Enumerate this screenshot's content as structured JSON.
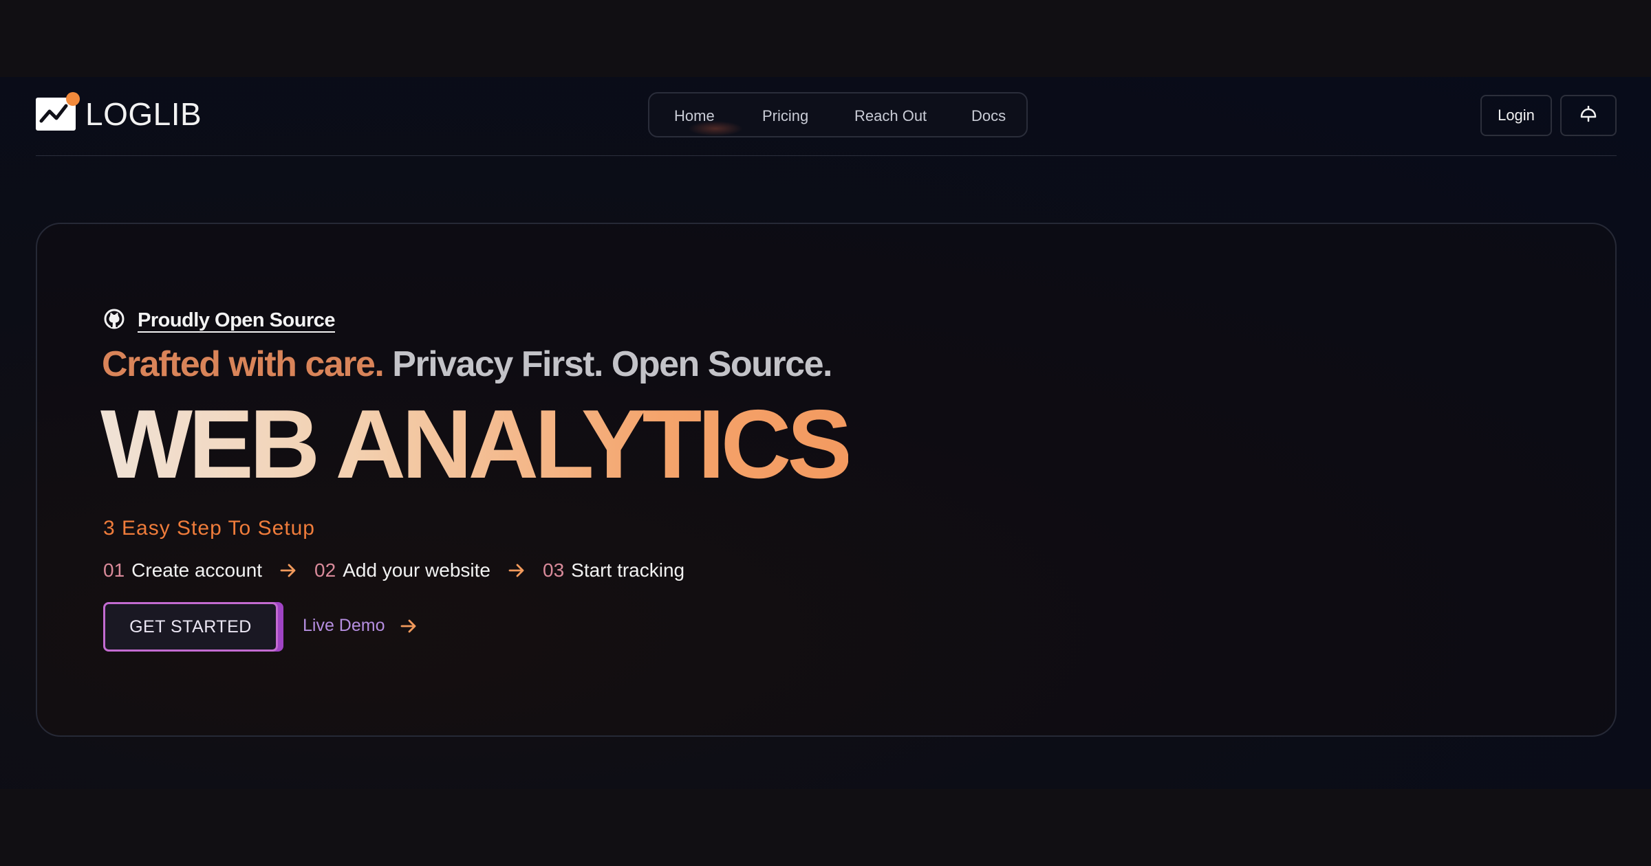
{
  "header": {
    "logo_text": "LOGLIB",
    "nav": [
      {
        "label": "Home"
      },
      {
        "label": "Pricing"
      },
      {
        "label": "Reach Out"
      },
      {
        "label": "Docs"
      }
    ],
    "login_label": "Login",
    "theme_icon": "lamp-icon"
  },
  "hero": {
    "open_source_icon": "github-icon",
    "open_source_link": "Proudly Open Source",
    "tagline_highlight": "Crafted with care.",
    "tagline_rest": "Privacy First. Open Source.",
    "headline": "WEB ANALYTICS",
    "steps_title": "3 Easy Step To Setup",
    "steps": [
      {
        "num": "01",
        "label": "Create account"
      },
      {
        "num": "02",
        "label": "Add your website"
      },
      {
        "num": "03",
        "label": "Start tracking"
      }
    ],
    "cta_label": "GET STARTED",
    "live_demo_label": "Live Demo"
  },
  "colors": {
    "accent_orange": "#ef7c3b",
    "accent_purple": "#a044c4",
    "step_number": "#d98a9a",
    "background": "#0b0c15"
  }
}
